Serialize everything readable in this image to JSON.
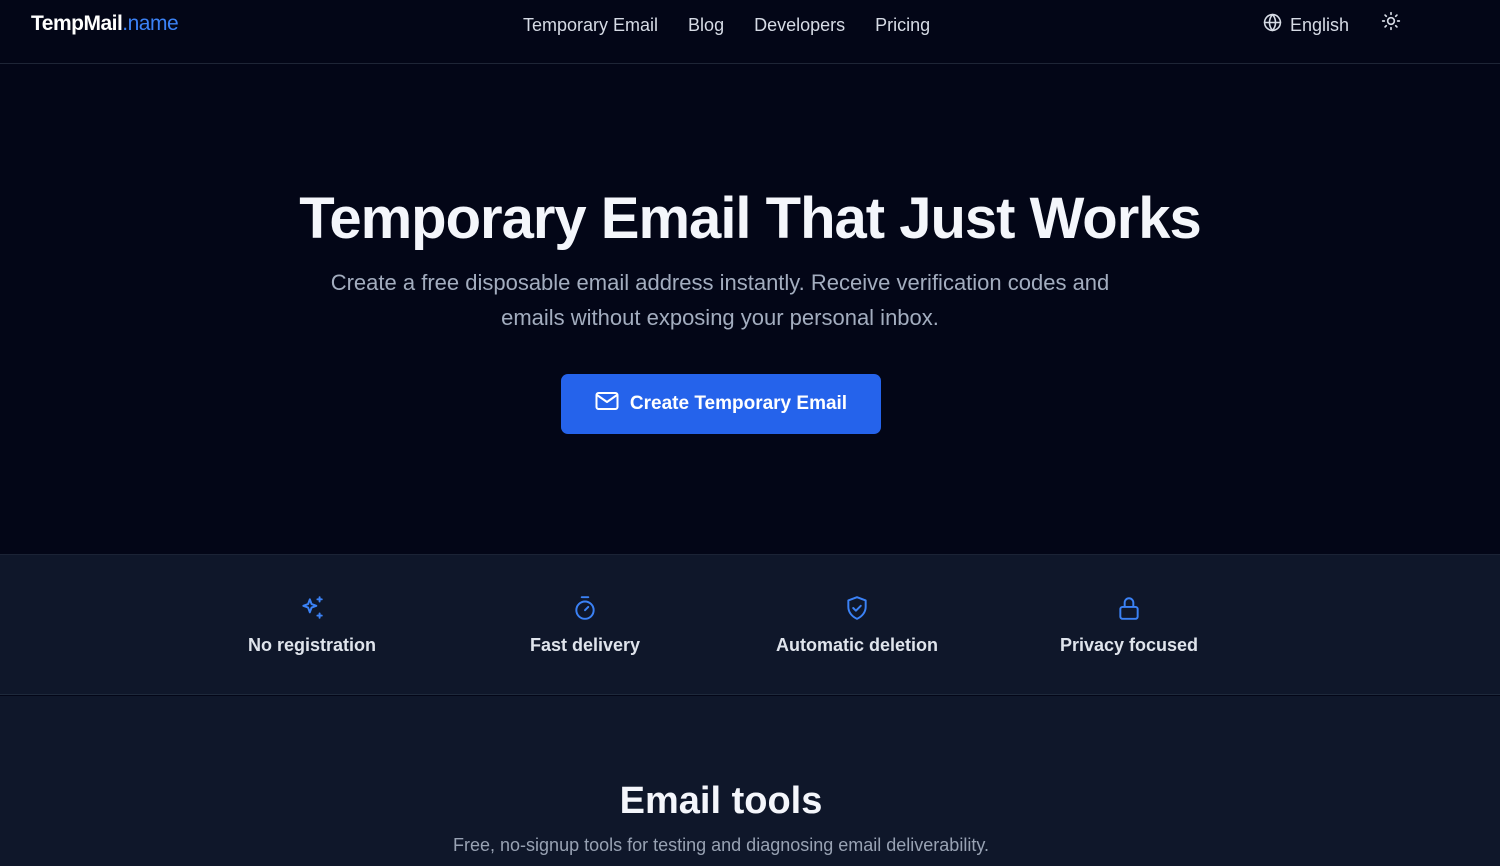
{
  "header": {
    "logo_main": "TempMail",
    "logo_domain": ".name",
    "nav": [
      "Temporary Email",
      "Blog",
      "Developers",
      "Pricing"
    ],
    "language": "English",
    "language_icon": "globe-icon",
    "theme_icon": "sun-icon"
  },
  "hero": {
    "title": "Temporary Email That Just Works",
    "subtitle": "Create a free disposable email address instantly. Receive verification codes and emails without exposing your personal inbox.",
    "cta_label": "Create Temporary Email",
    "cta_icon": "mail-icon"
  },
  "features": [
    {
      "label": "No registration",
      "icon": "sparkles-icon"
    },
    {
      "label": "Fast delivery",
      "icon": "timer-icon"
    },
    {
      "label": "Automatic deletion",
      "icon": "shield-check-icon"
    },
    {
      "label": "Privacy focused",
      "icon": "lock-icon"
    }
  ],
  "tools": {
    "title": "Email tools",
    "subtitle": "Free, no-signup tools for testing and diagnosing email deliverability."
  },
  "colors": {
    "background": "#030617",
    "section": "#0f172a",
    "accent": "#2563eb",
    "accent_text": "#3b82f6"
  }
}
